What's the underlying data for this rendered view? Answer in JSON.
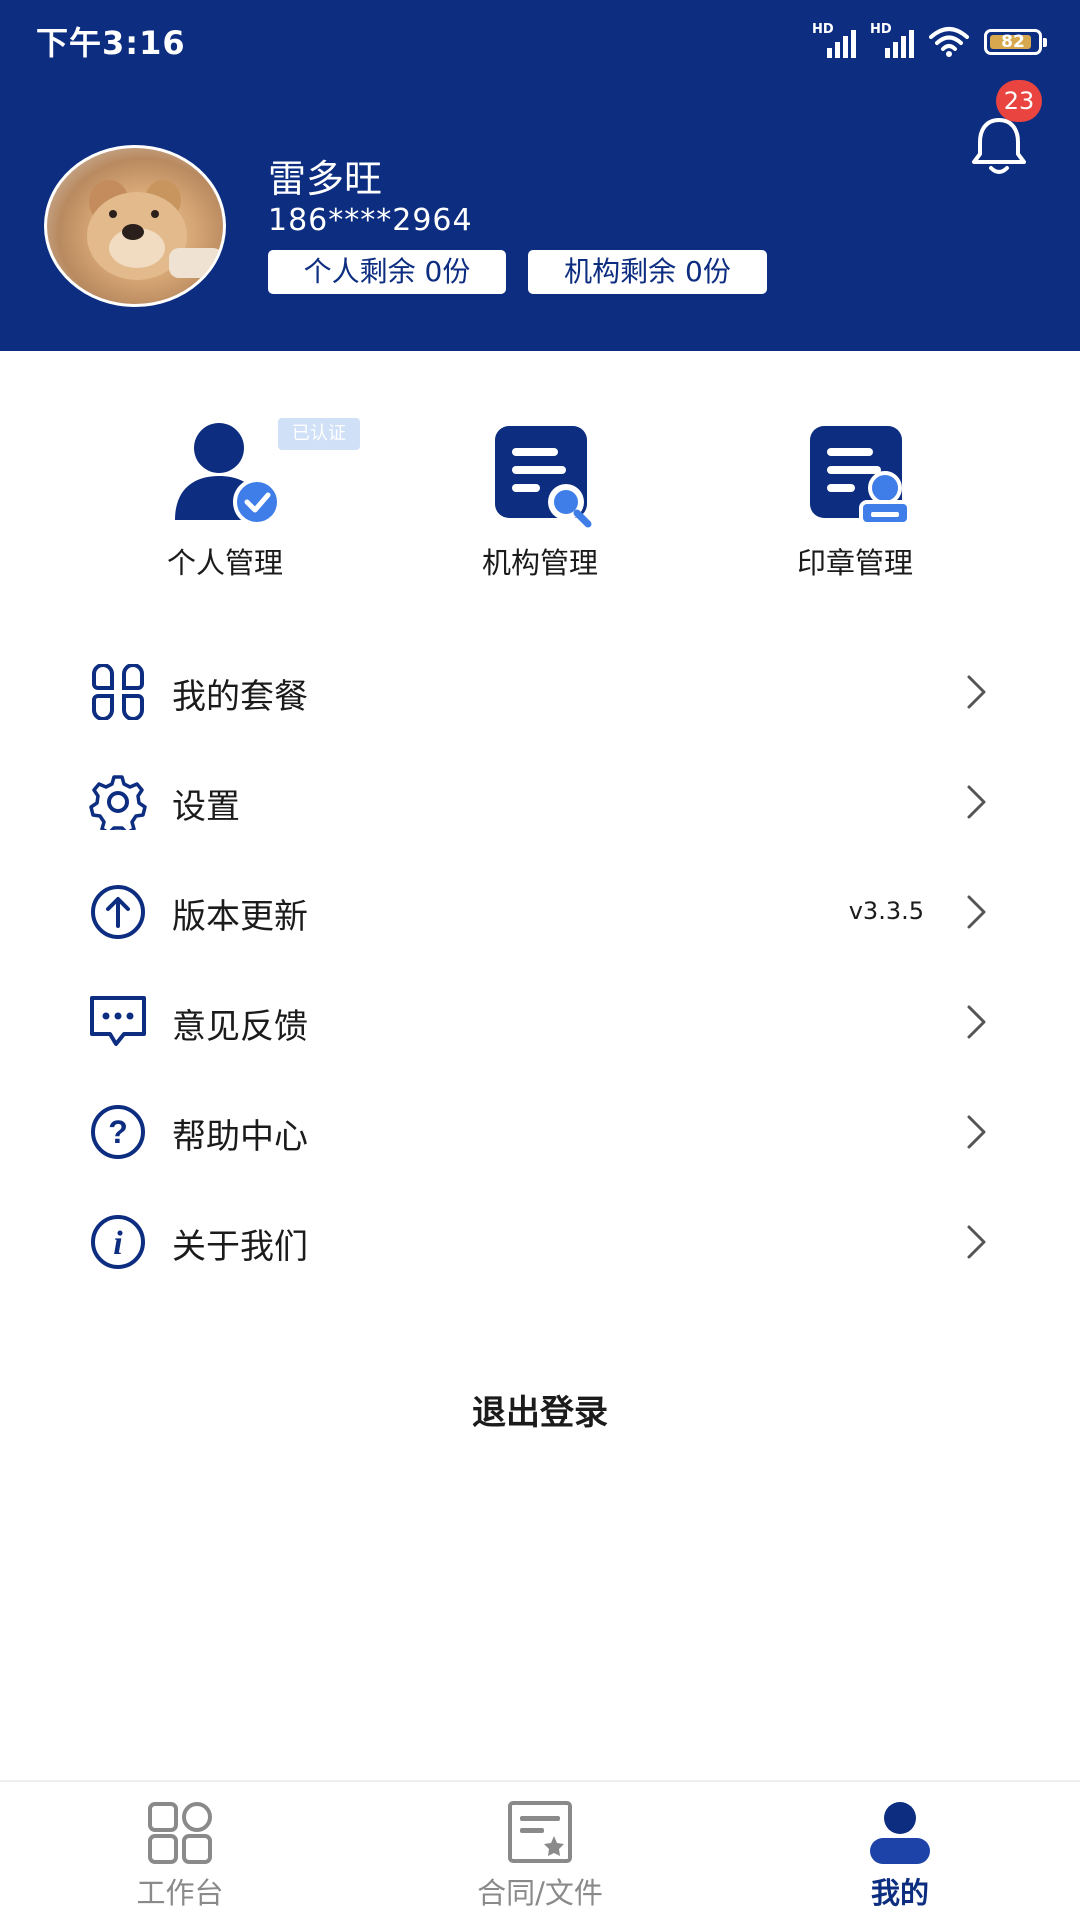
{
  "status_bar": {
    "time": "下午3:16",
    "signal_label_1": "HD",
    "signal_label_2": "HD",
    "battery": "82"
  },
  "profile": {
    "name": "雷多旺",
    "phone": "186****2964",
    "personal_quota": "个人剩余 0份",
    "org_quota": "机构剩余 0份"
  },
  "notifications": {
    "count": "23"
  },
  "quick_actions": {
    "verified_tag": "已认证",
    "items": [
      {
        "label": "个人管理",
        "icon": "user-verified-icon"
      },
      {
        "label": "机构管理",
        "icon": "org-document-search-icon"
      },
      {
        "label": "印章管理",
        "icon": "seal-document-icon"
      }
    ]
  },
  "menu": [
    {
      "label": "我的套餐",
      "icon": "grid-package-icon",
      "value": ""
    },
    {
      "label": "设置",
      "icon": "gear-icon",
      "value": ""
    },
    {
      "label": "版本更新",
      "icon": "upload-arrow-icon",
      "value": "v3.3.5"
    },
    {
      "label": "意见反馈",
      "icon": "chat-bubble-icon",
      "value": ""
    },
    {
      "label": "帮助中心",
      "icon": "question-icon",
      "value": ""
    },
    {
      "label": "关于我们",
      "icon": "info-icon",
      "value": ""
    }
  ],
  "logout_label": "退出登录",
  "tabs": [
    {
      "label": "工作台",
      "icon": "grid-icon",
      "active": false
    },
    {
      "label": "合同/文件",
      "icon": "contract-file-icon",
      "active": false
    },
    {
      "label": "我的",
      "icon": "user-icon",
      "active": true
    }
  ],
  "colors": {
    "primary": "#0c2d80",
    "accent": "#3f7de8",
    "badge": "#e9443f"
  }
}
